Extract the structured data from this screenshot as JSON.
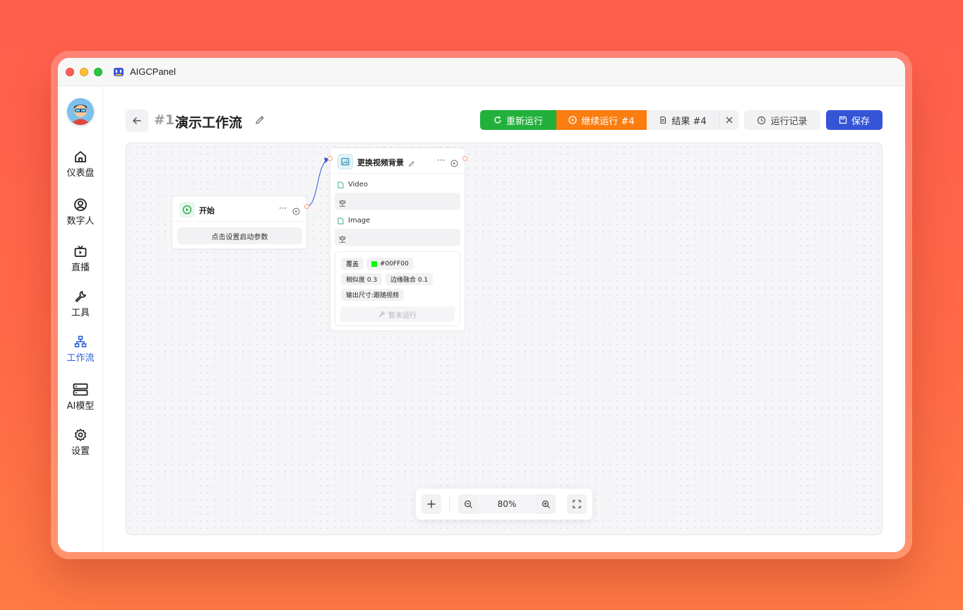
{
  "app": {
    "title": "AIGCPanel"
  },
  "sidebar": {
    "items": [
      {
        "label": "仪表盘",
        "icon": "home-icon"
      },
      {
        "label": "数字人",
        "icon": "user-circle-icon"
      },
      {
        "label": "直播",
        "icon": "tv-icon"
      },
      {
        "label": "工具",
        "icon": "wrench-icon"
      },
      {
        "label": "工作流",
        "icon": "workflow-icon",
        "active": true
      },
      {
        "label": "AI模型",
        "icon": "server-icon"
      },
      {
        "label": "设置",
        "icon": "gear-icon"
      }
    ]
  },
  "header": {
    "number": "#1",
    "title": "演示工作流"
  },
  "toolbar": {
    "rerun_label": "重新运行",
    "continue_label": "继续运行 #4",
    "result_label": "结果 #4",
    "history_label": "运行记录",
    "save_label": "保存"
  },
  "nodes": {
    "start": {
      "title": "开始",
      "param_button": "点击设置启动参数"
    },
    "replace_bg": {
      "title": "更换视频背景",
      "video_label": "Video",
      "video_value": "空",
      "image_label": "Image",
      "image_value": "空",
      "tags": {
        "mode": "覆盖",
        "color": "#00FF00",
        "similarity": "相似度 0.3",
        "edge_blend": "边缘融合 0.1",
        "output_size": "输出尺寸:跟随视频"
      },
      "status": "暂未运行"
    }
  },
  "zoom": {
    "level": "80%"
  },
  "colors": {
    "rerun": "#21b13b",
    "continue": "#fa7d10",
    "save": "#3555d6",
    "active_nav": "#2c5fd9",
    "color_swatch": "#00ff00"
  }
}
